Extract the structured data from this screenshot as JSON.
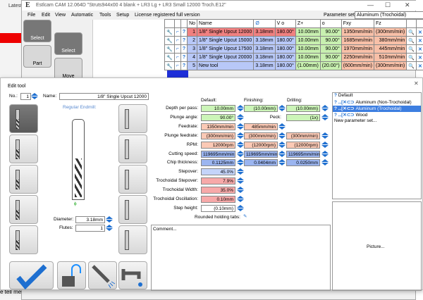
{
  "browser": {
    "tab": "Latest",
    "footer_text": "e tell me"
  },
  "app": {
    "title": "Estlcam CAM 12.064D \"Struts944x00 4 blank + LR3 Lg + LR3 Small 12000 Troch.E12\"",
    "menu": [
      "File",
      "Edit",
      "View",
      "Automatic",
      "Tools",
      "Setup",
      "License registered full version"
    ],
    "parameter_set_label": "Parameter set:",
    "parameter_set_value": "Aluminum (Trochoidal)",
    "left_toolbar": [
      "Select",
      "Part",
      "Select",
      "Move"
    ]
  },
  "tools_table": {
    "headers": [
      "No",
      "Name",
      "Ø",
      "V o",
      "Z+",
      "o",
      "Fxy",
      "Fz"
    ],
    "rows": [
      [
        "1",
        "1/8\" Single Upcut 12000",
        "3.18mm",
        "180.00°",
        "10.00mm",
        "90.00°",
        "1350mm/min",
        "(300mm/min)"
      ],
      [
        "2",
        "1/8\" Single Upcut 15000",
        "3.18mm",
        "180.00°",
        "10.00mm",
        "90.00°",
        "1685mm/min",
        "380mm/min"
      ],
      [
        "3",
        "1/8\" Single Upcut 17500",
        "3.18mm",
        "180.00°",
        "10.00mm",
        "90.00°",
        "1970mm/min",
        "445mm/min"
      ],
      [
        "4",
        "1/8\" Single Upcut 20000",
        "3.18mm",
        "180.00°",
        "10.00mm",
        "90.00°",
        "2250mm/min",
        "510mm/min"
      ],
      [
        "5",
        "New tool",
        "3.18mm",
        "180.00°",
        "(1.00mm)",
        "(20.00°)",
        "(600mm/min)",
        "(300mm/min)"
      ]
    ]
  },
  "dialog": {
    "title": "Edit tool",
    "no_label": "No.:",
    "no_value": "1",
    "name_label": "Name:",
    "name_value": "1/8\" Single Upcut 12000",
    "tool_type": "Regular Endmill:",
    "diameter_label": "Diameter:",
    "diameter_value": "3.18mm",
    "flutes_label": "Flutes:",
    "flutes_value": "1",
    "col_default": "Default:",
    "col_finishing": "Finishing:",
    "col_drilling": "Drilling:",
    "params": [
      {
        "label": "Depth per pass:",
        "default": "10.00mm",
        "finishing": "(10.00mm)",
        "drilling": "(10.00mm)"
      },
      {
        "label": "Plunge angle:",
        "default": "90.00°",
        "peck_label": "Peck:",
        "drilling": "(1x)"
      },
      {
        "label": "Feedrate:",
        "default": "1350mm/min",
        "finishing": "485mm/min"
      },
      {
        "label": "Plunge feedrate:",
        "default": "(300mm/min)",
        "finishing": "(300mm/min)",
        "drilling": "(300mm/min)"
      },
      {
        "label": "RPM:",
        "default": "12000rpm",
        "finishing": "(12000rpm)",
        "drilling": "(12000rpm)"
      },
      {
        "label": "Cutting speed:",
        "default": "119695mm/min",
        "finishing": "119695mm/min",
        "drilling": "119695mm/min"
      },
      {
        "label": "Chip thickness:",
        "default": "0.1125mm",
        "finishing": "0.0404mm",
        "drilling": "0.0250mm"
      },
      {
        "label": "Stepover:",
        "default": "45.0%"
      },
      {
        "label": "Trochoidal Stepover:",
        "default": "7.9%"
      },
      {
        "label": "Trochoidal Width:",
        "default": "35.0%"
      },
      {
        "label": "Trochoidal Oscillation:",
        "default": "0.10mm"
      },
      {
        "label": "Step height:",
        "default": "(0.10mm)"
      }
    ],
    "rounded_tabs_label": "Rounded holding tabs:",
    "comment_label": "Comment...",
    "parameter_sets": [
      "Default",
      "Aluminum (Non-Trochoidal)",
      "Aluminum (Trochoidal)",
      "Wood",
      "New parameter set..."
    ],
    "selected_set": "Aluminum (Trochoidal)",
    "picture_label": "Picture..."
  },
  "colors": {
    "accent": "#1e6fd0",
    "selected": "#3d7ee0"
  }
}
